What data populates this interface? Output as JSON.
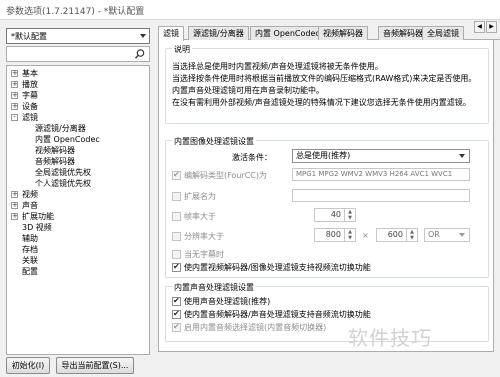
{
  "window": {
    "title": "参数选项(1.7.21147) - *默认配置"
  },
  "left": {
    "profile": "*默认配置",
    "search_placeholder": "",
    "tree": [
      {
        "label": "基本",
        "level": 0,
        "exp": "+"
      },
      {
        "label": "播放",
        "level": 0,
        "exp": "+"
      },
      {
        "label": "字幕",
        "level": 0,
        "exp": "+"
      },
      {
        "label": "设备",
        "level": 0,
        "exp": "+"
      },
      {
        "label": "滤镜",
        "level": 0,
        "exp": "-"
      },
      {
        "label": "源滤镜/分离器",
        "level": 1
      },
      {
        "label": "内置 OpenCodec",
        "level": 1
      },
      {
        "label": "视频解码器",
        "level": 1
      },
      {
        "label": "音频解码器",
        "level": 1
      },
      {
        "label": "全局滤镜优先权",
        "level": 1
      },
      {
        "label": "个人滤镜优先权",
        "level": 1
      },
      {
        "label": "视频",
        "level": 0,
        "exp": "+"
      },
      {
        "label": "声音",
        "level": 0,
        "exp": "+"
      },
      {
        "label": "扩展功能",
        "level": 0,
        "exp": "+"
      },
      {
        "label": "3D 视频",
        "level": 0
      },
      {
        "label": "辅助",
        "level": 0
      },
      {
        "label": "存档",
        "level": 0
      },
      {
        "label": "关联",
        "level": 0
      },
      {
        "label": "配置",
        "level": 0
      }
    ],
    "init_button": "初始化(I)",
    "export_button": "导出当前配置(S)..."
  },
  "tabs": [
    "滤镜",
    "源滤镜/分离器",
    "内置 OpenCodec",
    "视频解码器",
    "音频解码器",
    "全局滤镜"
  ],
  "desc": {
    "title": "说明",
    "lines": [
      "当选择总是使用时内置视频/声音处理滤镜将被无条件使用。",
      "当选择按条件使用时将根据当前播放文件的编码压缩格式(RAW格式)来决定是否使用。",
      "内置声音处理滤镜可用在声音录制功能中。",
      "在没有需利用外部视频/声音滤镜处理的特殊情况下建议您选择无条件使用内置滤镜。"
    ]
  },
  "video": {
    "title": "内置图像处理滤镜设置",
    "activate_label": "激活条件：",
    "activate_value": "总是使用(推荐)",
    "fourcc_label": "编解码类型(FourCC)为",
    "fourcc_value": "MPG1 MPG2 WMV2 WMV3 H264 AVC1 WVC1",
    "ext_label": "扩展名为",
    "ext_value": "",
    "fps_label": "帧率大于",
    "fps_value": "40",
    "res_label": "分辨率大于",
    "res_w": "800",
    "res_x": "×",
    "res_h": "600",
    "res_op": "OR",
    "nosub_label": "当无字幕时",
    "switch_label": "使内置视频解码器/图像处理滤镜支持视频流切换功能"
  },
  "audio": {
    "title": "内置声音处理滤镜设置",
    "use_label": "使用声音处理滤镜(推荐)",
    "switch_label": "使内置音频解码器/声音处理滤镜支持音频流切换功能",
    "sync_label": "启用内置音频选择滤镜(内置音频切换器)"
  },
  "watermark": "软件技巧",
  "colors": {
    "accent": "#dbe8f7",
    "disabled": "#8d8d8d"
  }
}
